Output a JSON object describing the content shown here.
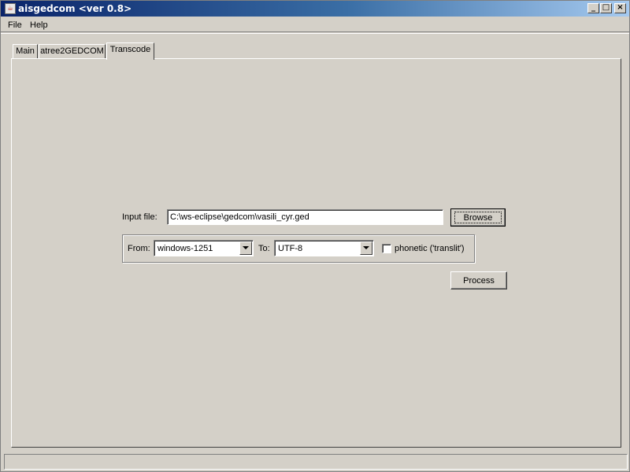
{
  "window": {
    "title": "aisgedcom <ver 0.8>",
    "icon": "java-cup-icon",
    "buttons": {
      "minimize": "_",
      "maximize": "□",
      "close": "×"
    }
  },
  "menubar": {
    "items": [
      {
        "label": "File"
      },
      {
        "label": "Help"
      }
    ]
  },
  "tabs": [
    {
      "label": "Main",
      "selected": false
    },
    {
      "label": "atree2GEDCOM",
      "selected": false
    },
    {
      "label": "Transcode",
      "selected": true
    }
  ],
  "transcode": {
    "input_file_label": "Input file:",
    "input_file_value": "C:\\ws-eclipse\\gedcom\\vasili_cyr.ged",
    "browse_label": "Browse",
    "from_label": "From:",
    "from_value": "windows-1251",
    "to_label": "To:",
    "to_value": "UTF-8",
    "phonetic_label": "phonetic ('translit')",
    "phonetic_checked": false,
    "process_label": "Process"
  },
  "statusbar": {
    "text": ""
  },
  "colors": {
    "window_bg": "#d4d0c8",
    "titlebar_start": "#0a246a",
    "titlebar_end": "#a6caf0",
    "field_bg": "#ffffff"
  }
}
